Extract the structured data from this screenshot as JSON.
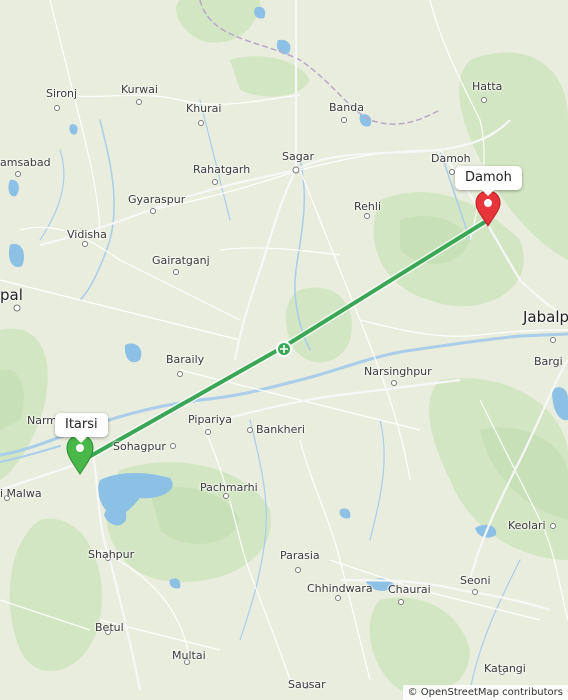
{
  "map": {
    "origin_label": "Itarsi",
    "destination_label": "Damoh",
    "attribution": "© OpenStreetMap contributors",
    "route_color": "#3aa757",
    "destination_pin_color": "#e8343b",
    "origin_pin_color": "#49b849",
    "places": [
      {
        "id": "sironj",
        "name": "Sironj"
      },
      {
        "id": "kurwai",
        "name": "Kurwai"
      },
      {
        "id": "khurai",
        "name": "Khurai"
      },
      {
        "id": "banda",
        "name": "Banda"
      },
      {
        "id": "hatta",
        "name": "Hatta"
      },
      {
        "id": "ganj-basoda",
        "name": "amsabad"
      },
      {
        "id": "rahatgarh",
        "name": "Rahatgarh"
      },
      {
        "id": "sagar",
        "name": "Sagar"
      },
      {
        "id": "damoh-town",
        "name": "Damoh"
      },
      {
        "id": "gyaraspur",
        "name": "Gyaraspur"
      },
      {
        "id": "rehli",
        "name": "Rehli"
      },
      {
        "id": "vidisha",
        "name": "Vidisha"
      },
      {
        "id": "gairatganj",
        "name": "Gairatganj"
      },
      {
        "id": "bhopal",
        "name": "pal"
      },
      {
        "id": "jabalpur",
        "name": "Jabalp"
      },
      {
        "id": "bargi",
        "name": "Bargi"
      },
      {
        "id": "baraily",
        "name": "Baraily"
      },
      {
        "id": "narsinghpur",
        "name": "Narsinghpur"
      },
      {
        "id": "piparia",
        "name": "Pipariya"
      },
      {
        "id": "narmada",
        "name": "Narm"
      },
      {
        "id": "sohagpur",
        "name": "Sohagpur"
      },
      {
        "id": "bankheri",
        "name": "Bankheri"
      },
      {
        "id": "pachmarhi",
        "name": "Pachmarhi"
      },
      {
        "id": "harda",
        "name": "i Malwa"
      },
      {
        "id": "keolari",
        "name": "Keolari"
      },
      {
        "id": "shahpur",
        "name": "Shahpur"
      },
      {
        "id": "parasia",
        "name": "Parasia"
      },
      {
        "id": "chhindwara",
        "name": "Chhindwara"
      },
      {
        "id": "chaurai",
        "name": "Chaurai"
      },
      {
        "id": "seoni",
        "name": "Seoni"
      },
      {
        "id": "betul",
        "name": "Betul"
      },
      {
        "id": "multai",
        "name": "Multai"
      },
      {
        "id": "sausar",
        "name": "Sausar"
      },
      {
        "id": "katangi",
        "name": "Katangi"
      }
    ]
  }
}
